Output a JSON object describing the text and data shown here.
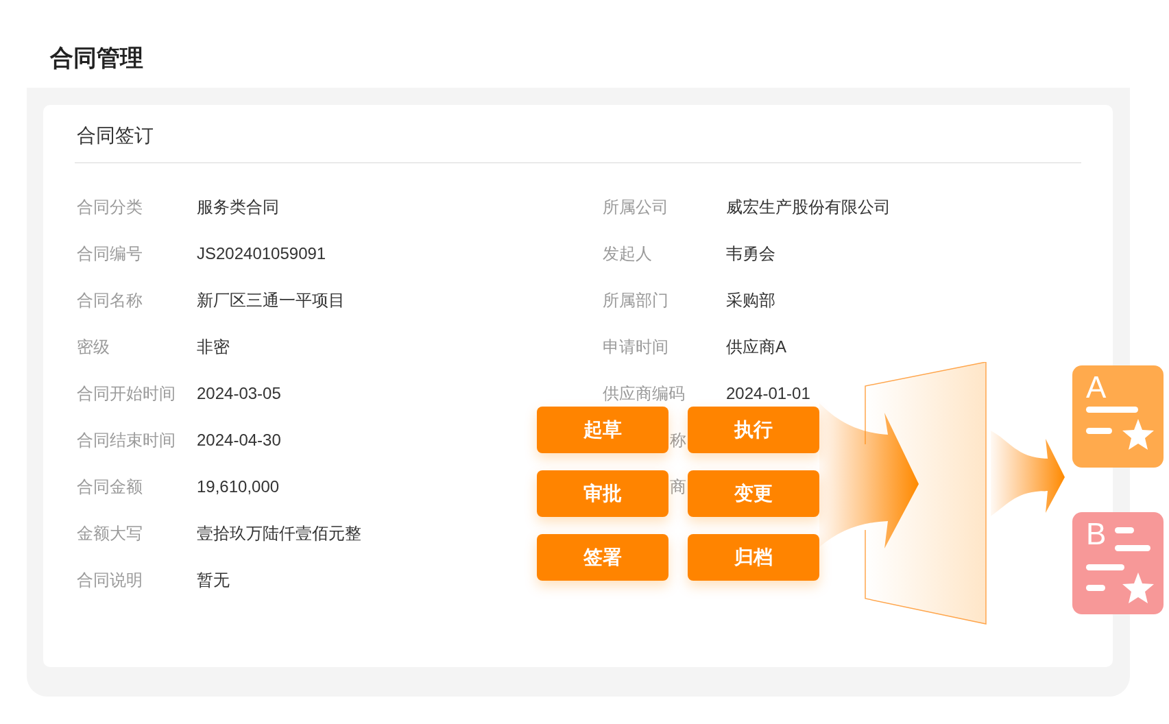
{
  "page_title": "合同管理",
  "card": {
    "title": "合同签订",
    "left_fields": [
      {
        "label": "合同分类",
        "value": "服务类合同"
      },
      {
        "label": "合同编号",
        "value": "JS202401059091"
      },
      {
        "label": "合同名称",
        "value": "新厂区三通一平项目"
      },
      {
        "label": "密级",
        "value": "非密"
      },
      {
        "label": "合同开始时间",
        "value": "2024-03-05"
      },
      {
        "label": "合同结束时间",
        "value": "2024-04-30"
      },
      {
        "label": "合同金额",
        "value": "19,610,000"
      },
      {
        "label": "金额大写",
        "value": "壹拾玖万陆仟壹佰元整"
      },
      {
        "label": "合同说明",
        "value": "暂无"
      }
    ],
    "right_fields": [
      {
        "kind": "full",
        "label": "所属公司",
        "value": "威宏生产股份有限公司"
      },
      {
        "kind": "full",
        "label": "发起人",
        "value": "韦勇会"
      },
      {
        "kind": "full",
        "label": "所属部门",
        "value": "采购部"
      },
      {
        "kind": "full",
        "label": "申请时间",
        "value": "供应商A"
      },
      {
        "kind": "full",
        "label": "供应商编码",
        "value": "2024-01-01"
      },
      {
        "kind": "covered",
        "label": "称"
      },
      {
        "kind": "covered",
        "label": "商"
      }
    ]
  },
  "stage_buttons": [
    "起草",
    "执行",
    "审批",
    "变更",
    "签署",
    "归档"
  ],
  "result_cards": [
    {
      "letter": "A",
      "color": "#ffaa4d"
    },
    {
      "letter": "B",
      "color": "#f79898"
    }
  ]
}
